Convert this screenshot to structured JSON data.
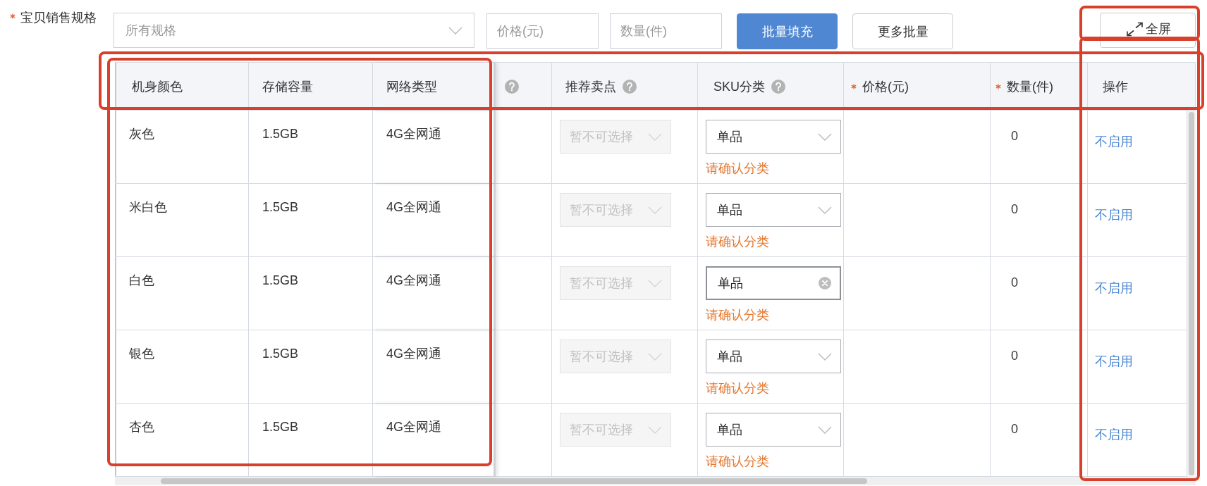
{
  "form": {
    "label": "宝贝销售规格",
    "required": true
  },
  "toolbar": {
    "spec_select": {
      "placeholder": "所有规格"
    },
    "price_input": {
      "placeholder": "价格(元)"
    },
    "quantity_input": {
      "placeholder": "数量(件)"
    },
    "buttons": [
      {
        "label": "批量填充",
        "kind": "primary"
      },
      {
        "label": "更多批量",
        "kind": "default"
      }
    ],
    "fullscreen_button": {
      "label": "全屏",
      "highlighted": true
    }
  },
  "table": {
    "header_highlighted": true,
    "columns": [
      {
        "label": "机身颜色",
        "required": false,
        "help": false,
        "highlighted": true
      },
      {
        "label": "存储容量",
        "required": false,
        "help": false,
        "highlighted": true
      },
      {
        "label": "网络类型",
        "required": false,
        "help": false,
        "highlighted": true
      },
      {
        "required": false,
        "help": true,
        "highlighted": false
      },
      {
        "label": "推荐卖点",
        "required": false,
        "help": true,
        "highlighted": false
      },
      {
        "label": "SKU分类",
        "required": false,
        "help": true,
        "highlighted": false
      },
      {
        "label": "价格(元)",
        "required": true,
        "help": false,
        "highlighted": false
      },
      {
        "label": "数量(件)",
        "required": true,
        "help": false,
        "highlighted": false
      },
      {
        "label": "操作",
        "required": false,
        "help": false,
        "highlighted": true
      }
    ],
    "rows": [
      {
        "spec_values": [
          "灰色",
          "1.5GB",
          "4G全网通"
        ],
        "selling_point": {
          "placeholder": "暂不可选择",
          "disabled": true
        },
        "sku_category": {
          "value": "单品",
          "hovered": false,
          "warning": "请确认分类"
        },
        "quantity": "0",
        "action": "不启用"
      },
      {
        "spec_values": [
          "米白色",
          "1.5GB",
          "4G全网通"
        ],
        "selling_point": {
          "placeholder": "暂不可选择",
          "disabled": true
        },
        "sku_category": {
          "value": "单品",
          "hovered": false,
          "warning": "请确认分类"
        },
        "quantity": "0",
        "action": "不启用"
      },
      {
        "spec_values": [
          "白色",
          "1.5GB",
          "4G全网通"
        ],
        "selling_point": {
          "placeholder": "暂不可选择",
          "disabled": true
        },
        "sku_category": {
          "value": "单品",
          "hovered": true,
          "warning": "请确认分类"
        },
        "quantity": "0",
        "action": "不启用"
      },
      {
        "spec_values": [
          "银色",
          "1.5GB",
          "4G全网通"
        ],
        "selling_point": {
          "placeholder": "暂不可选择",
          "disabled": true
        },
        "sku_category": {
          "value": "单品",
          "hovered": false,
          "warning": "请确认分类"
        },
        "quantity": "0",
        "action": "不启用"
      },
      {
        "spec_values": [
          "杏色",
          "1.5GB",
          "4G全网通"
        ],
        "selling_point": {
          "placeholder": "暂不可选择",
          "disabled": true
        },
        "sku_category": {
          "value": "单品",
          "hovered": false,
          "warning": "请确认分类"
        },
        "quantity": "0",
        "action": "不启用"
      }
    ]
  }
}
